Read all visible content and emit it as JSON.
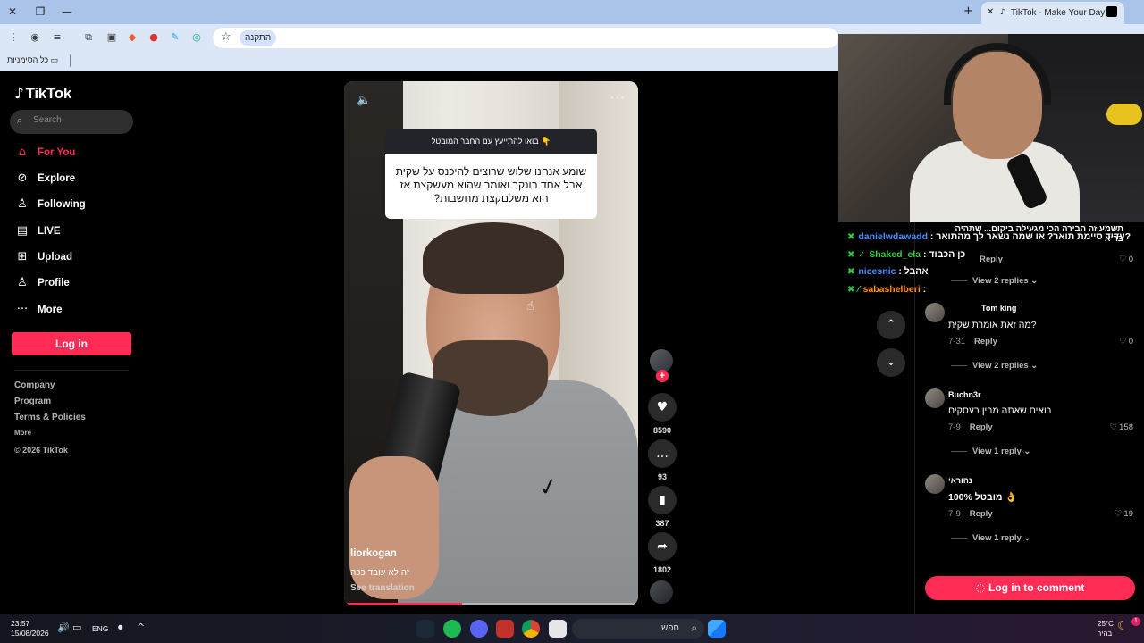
{
  "browser": {
    "tab_title": "TikTok - Make Your Day",
    "install_label": "התקנה",
    "bookmarks_all": "כל הסימניות"
  },
  "sidebar": {
    "logo": "TikTok",
    "search_placeholder": "Search",
    "nav": [
      {
        "label": "For You",
        "icon": "home-icon"
      },
      {
        "label": "Explore",
        "icon": "compass-icon"
      },
      {
        "label": "Following",
        "icon": "following-icon"
      },
      {
        "label": "LIVE",
        "icon": "live-icon"
      },
      {
        "label": "Upload",
        "icon": "upload-icon"
      },
      {
        "label": "Profile",
        "icon": "profile-icon"
      },
      {
        "label": "More",
        "icon": "more-icon"
      }
    ],
    "login_label": "Log in",
    "footer": [
      "Company",
      "Program",
      "Terms & Policies",
      "More",
      "© 2026 TikTok"
    ]
  },
  "video": {
    "banner": "בואו להתייעץ עם החבר המובטל 👇",
    "question": "שומע אנחנו שלוש שרוצים להיכנס על שקית אבל אחד בונקר ואומר שהוא מעשקצת אז הוא משלםקצת מחשבות?",
    "author": "liorkogan",
    "caption": "זה לא עובד ככה",
    "see_translation": "See translation",
    "progress_percent": 40
  },
  "actions": {
    "likes": "8590",
    "comments": "93",
    "saves": "387",
    "shares": "1802"
  },
  "stream_chat": [
    {
      "user": "danielwdawadd",
      "color": "#4a90ff",
      "message": ": עדיד סיימת תואר? או שמה נשאר לך מהתואר?"
    },
    {
      "user": "Shaked_ela",
      "color": "#2ecc40",
      "message": ": כן הכבוד"
    },
    {
      "user": "nicesnic",
      "color": "#4a90ff",
      "message": ": אהבל"
    },
    {
      "user": "sabashelberi",
      "color": "#ff8c1a",
      "message": ":"
    }
  ],
  "stream_chat_top": "תשמע זה הבירה הכי מגעילה ביקום... שתהיה בריא",
  "comments": {
    "c0": {
      "likes": "0",
      "reply": "Reply",
      "views": "View 2 replies"
    },
    "c1": {
      "name": "Tom king",
      "text": "מה זאת אומרת שקית?",
      "date": "7-31",
      "reply": "Reply",
      "likes": "0",
      "views": "View 2 replies"
    },
    "c2": {
      "name": "Buchn3r",
      "text": "רואים שאתה מבין בעסקים",
      "date": "7-9",
      "reply": "Reply",
      "likes": "158",
      "views": "View 1 reply"
    },
    "c3": {
      "name": "נהוראי",
      "text": "100% מובטל 👌",
      "date": "7-9",
      "reply": "Reply",
      "likes": "19",
      "views": "View 1 reply"
    },
    "login_label": "Log in to comment"
  },
  "taskbar": {
    "time": "23:57",
    "date": "15/08/2026",
    "lang": "ENG",
    "search": "חפש",
    "temp": "25°C",
    "weather": "בהיר",
    "notif": "1"
  }
}
